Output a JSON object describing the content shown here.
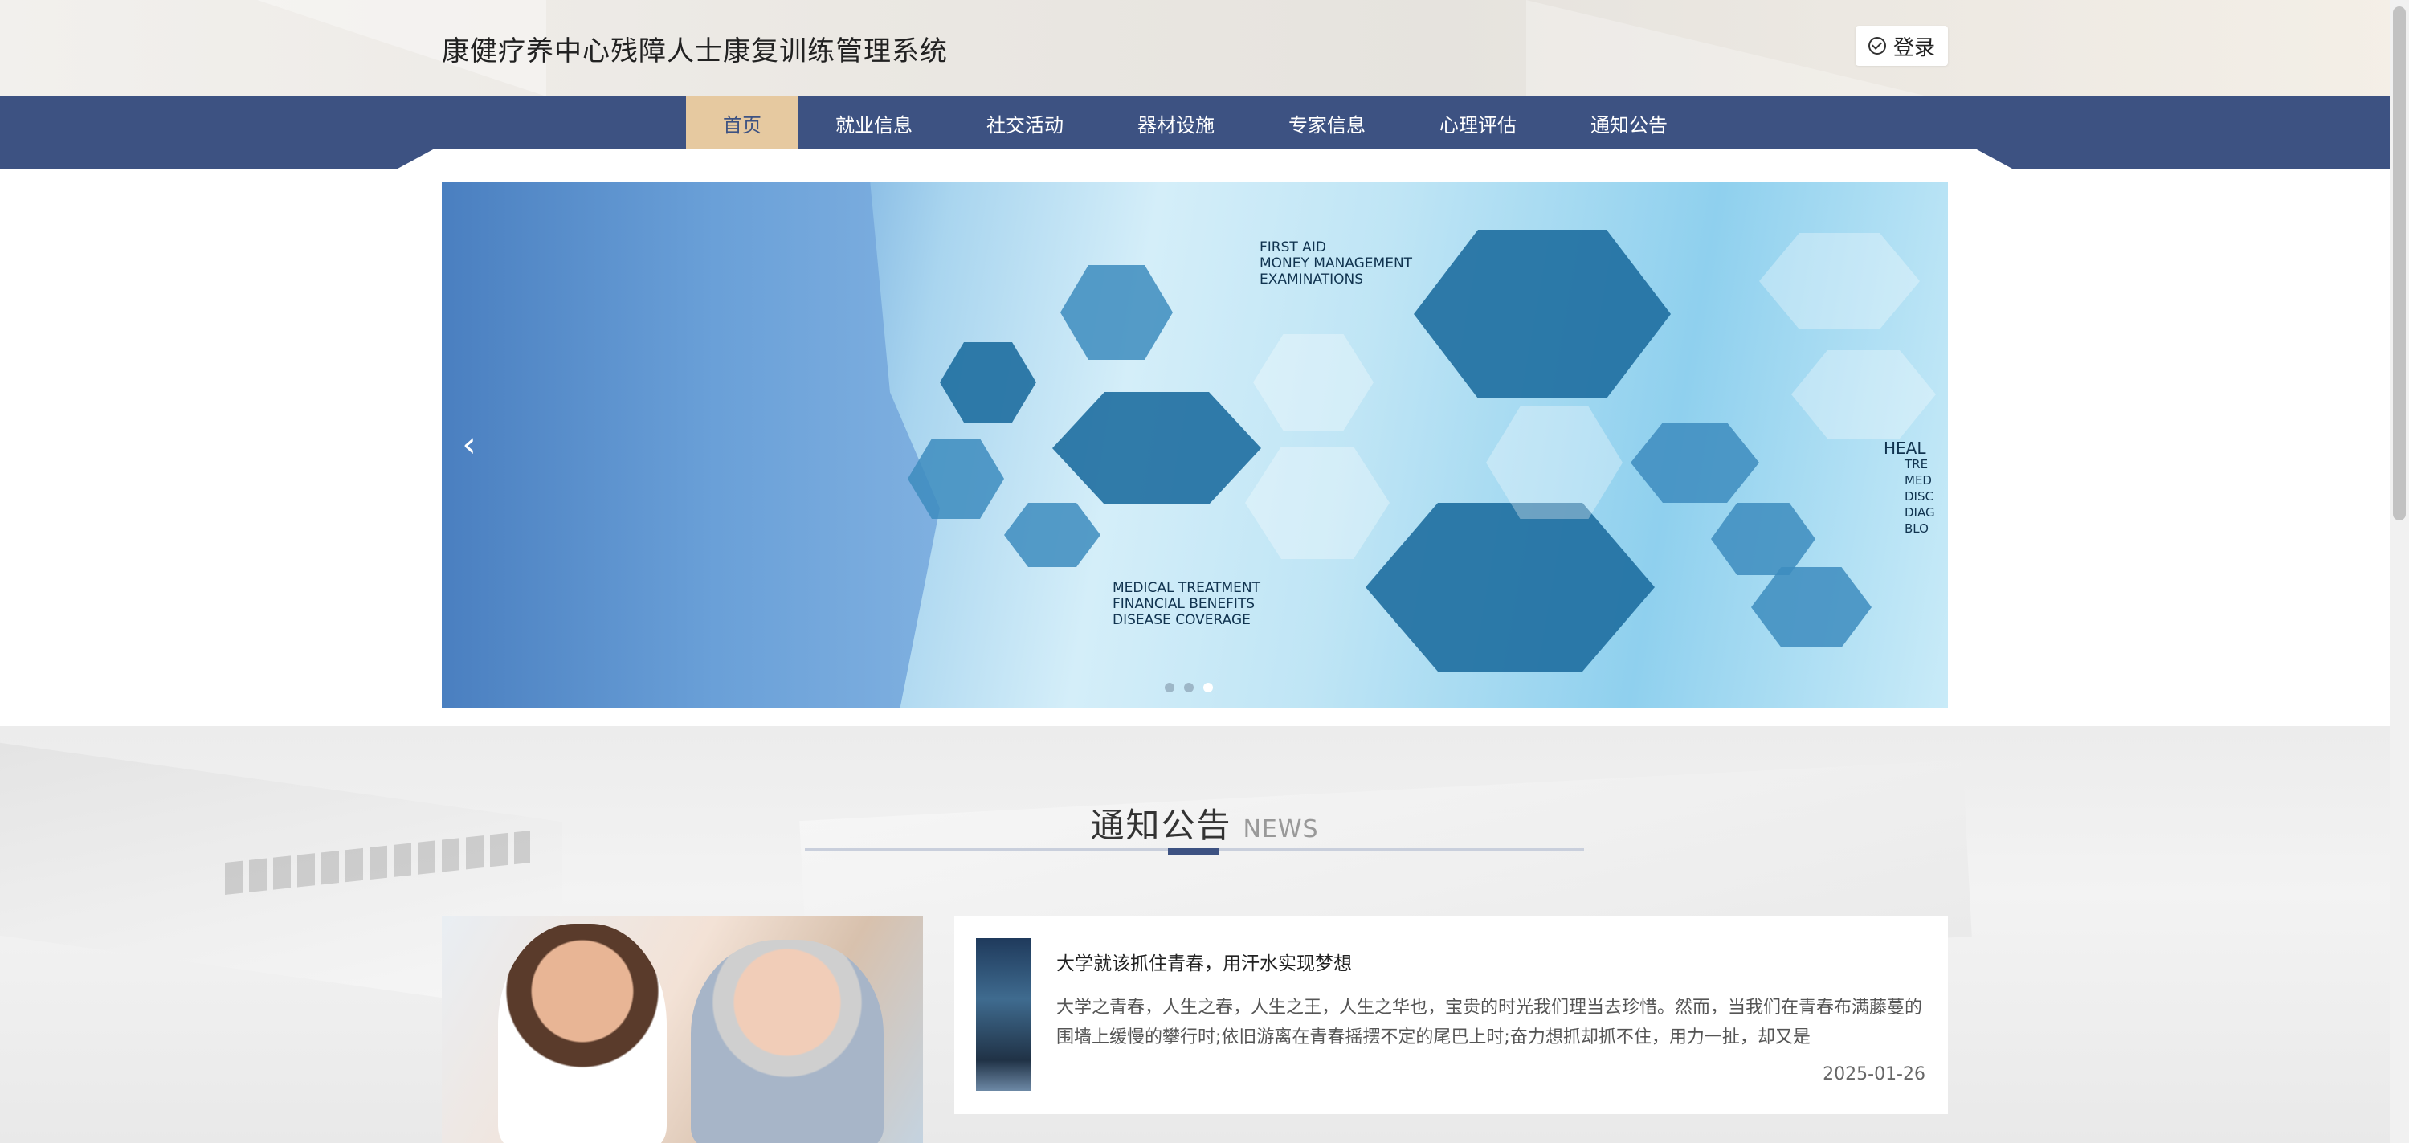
{
  "header": {
    "site_title": "康健疗养中心残障人士康复训练管理系统",
    "login_label": "登录"
  },
  "nav": {
    "items": [
      {
        "label": "首页",
        "active": true
      },
      {
        "label": "就业信息",
        "active": false
      },
      {
        "label": "社交活动",
        "active": false
      },
      {
        "label": "器材设施",
        "active": false
      },
      {
        "label": "专家信息",
        "active": false
      },
      {
        "label": "心理评估",
        "active": false
      },
      {
        "label": "通知公告",
        "active": false
      }
    ],
    "active_color": "#e6c9a0",
    "bar_color": "#3d5282"
  },
  "banner": {
    "text_top": [
      "FIRST AID",
      "MONEY MANAGEMENT",
      "EXAMINATIONS"
    ],
    "text_bottom": [
      "MEDICAL TREATMENT",
      "FINANCIAL BENEFITS",
      "DISEASE COVERAGE"
    ],
    "text_right": [
      "HEAL",
      "TRE",
      "MED",
      "DISC",
      "DIAG",
      "BLO"
    ],
    "prev_icon": "chevron-left-icon",
    "dots": 3,
    "active_dot": 2
  },
  "news_section": {
    "title": "通知公告",
    "title_en": "NEWS",
    "item": {
      "title": "大学就该抓住青春，用汗水实现梦想",
      "summary": "大学之青春，人生之春，人生之王，人生之华也，宝贵的时光我们理当去珍惜。然而，当我们在青春布满藤蔓的围墙上缓慢的攀行时;依旧游离在青春摇摆不定的尾巴上时;奋力想抓却抓不住，用力一扯，却又是",
      "date": "2025-01-26"
    }
  }
}
